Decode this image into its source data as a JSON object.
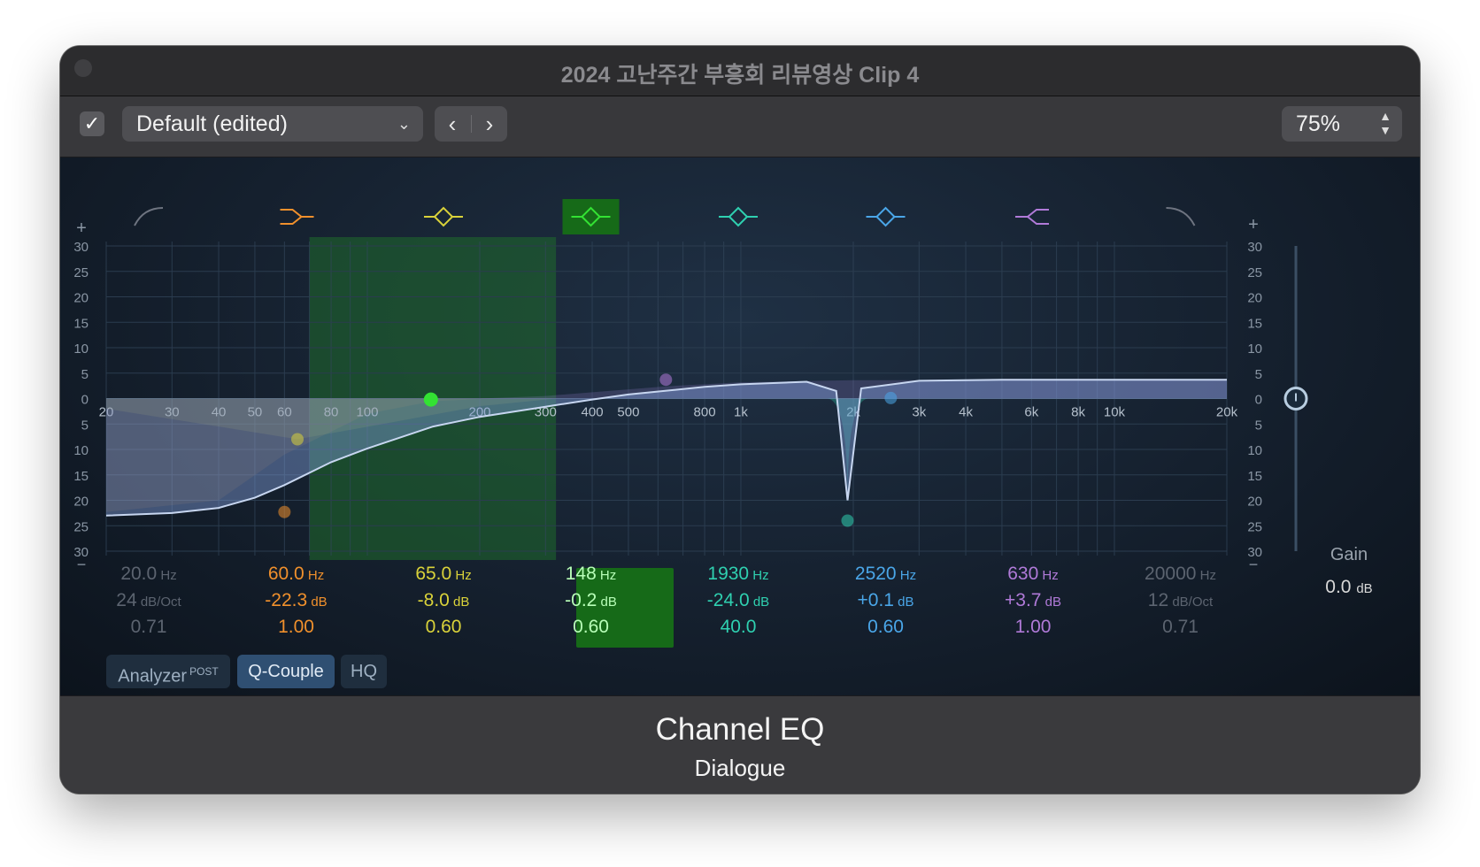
{
  "window": {
    "title": "2024 고난주간 부흥회 리뷰영상 Clip 4"
  },
  "toolbar": {
    "enabled_check": "✓",
    "preset": "Default (edited)",
    "prev": "‹",
    "next": "›",
    "zoom": "75%"
  },
  "graph": {
    "gain_scale_left": [
      "30",
      "25",
      "20",
      "15",
      "10",
      "5",
      "0",
      "5",
      "10",
      "15",
      "20",
      "25",
      "30"
    ],
    "gain_scale_right": [
      "30",
      "25",
      "20",
      "15",
      "10",
      "5",
      "0",
      "5",
      "10",
      "15",
      "20",
      "25",
      "30"
    ],
    "freq_labels": [
      "20",
      "30",
      "40",
      "50",
      "60",
      "80",
      "100",
      "200",
      "300",
      "400",
      "500",
      "800",
      "1k",
      "2k",
      "3k",
      "4k",
      "6k",
      "8k",
      "10k",
      "20k"
    ],
    "plus_left": "+",
    "minus_left": "−",
    "plus_right": "+",
    "minus_right": "−"
  },
  "bands": [
    {
      "type_icon": "low-cut-icon",
      "freq": "20.0",
      "freq_unit": "Hz",
      "gain": "24",
      "gain_unit": "dB/Oct",
      "q": "0.71",
      "color": "#6e7480",
      "enabled": false
    },
    {
      "type_icon": "low-shelf-icon",
      "freq": "60.0",
      "freq_unit": "Hz",
      "gain": "-22.3",
      "gain_unit": "dB",
      "q": "1.00",
      "color": "#f0902c",
      "enabled": true
    },
    {
      "type_icon": "bell-icon",
      "freq": "65.0",
      "freq_unit": "Hz",
      "gain": "-8.0",
      "gain_unit": "dB",
      "q": "0.60",
      "color": "#d9d23a",
      "enabled": true
    },
    {
      "type_icon": "bell-icon",
      "freq": "148",
      "freq_unit": "Hz",
      "gain": "-0.2",
      "gain_unit": "dB",
      "q": "0.60",
      "color": "#33e233",
      "enabled": true,
      "selected": true
    },
    {
      "type_icon": "bell-icon",
      "freq": "1930",
      "freq_unit": "Hz",
      "gain": "-24.0",
      "gain_unit": "dB",
      "q": "40.0",
      "color": "#2fd0b0",
      "enabled": true
    },
    {
      "type_icon": "bell-icon",
      "freq": "2520",
      "freq_unit": "Hz",
      "gain": "+0.1",
      "gain_unit": "dB",
      "q": "0.60",
      "color": "#4aa6e8",
      "enabled": true
    },
    {
      "type_icon": "high-shelf-icon",
      "freq": "630",
      "freq_unit": "Hz",
      "gain": "+3.7",
      "gain_unit": "dB",
      "q": "1.00",
      "color": "#b07ad8",
      "enabled": true
    },
    {
      "type_icon": "high-cut-icon",
      "freq": "20000",
      "freq_unit": "Hz",
      "gain": "12",
      "gain_unit": "dB/Oct",
      "q": "0.71",
      "color": "#6e7480",
      "enabled": false
    }
  ],
  "master": {
    "label": "Gain",
    "value": "0.0",
    "unit": "dB"
  },
  "buttons": {
    "analyzer": "Analyzer",
    "analyzer_sup": "POST",
    "qcouple": "Q-Couple",
    "hq": "HQ"
  },
  "footer": {
    "plugin": "Channel EQ",
    "track": "Dialogue"
  },
  "chart_data": {
    "type": "line",
    "xlabel": "",
    "ylabel": "",
    "xscale": "log",
    "xlim": [
      20,
      20000
    ],
    "ylim": [
      -30,
      30
    ],
    "series": [
      {
        "x": [
          20,
          30,
          40,
          50,
          60,
          80,
          100,
          150,
          200,
          300,
          400,
          500,
          800,
          1000,
          1500,
          1800,
          1930,
          2100,
          3000,
          5000,
          10000,
          20000
        ],
        "y": [
          -23,
          -22.5,
          -21.5,
          -19.5,
          -17,
          -12.5,
          -9.8,
          -5.5,
          -3.6,
          -1.6,
          -0.2,
          0.8,
          2.3,
          2.8,
          3.3,
          1.5,
          -20,
          2,
          3.5,
          3.7,
          3.7,
          3.7
        ]
      }
    ],
    "highlight_range_hz": [
      70,
      320
    ]
  }
}
